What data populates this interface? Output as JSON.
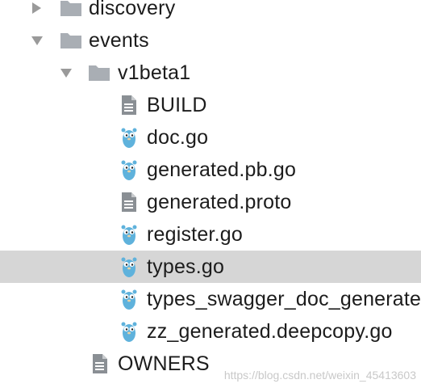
{
  "colors": {
    "folder": "#a9aeb4",
    "arrow": "#9a9a9a",
    "file": "#8a8f94",
    "gopher": "#5fb2dc",
    "selection": "#d6d6d6"
  },
  "tree": {
    "items": [
      {
        "label": "discovery",
        "type": "folder",
        "expanded": false,
        "icon": "folder-icon"
      },
      {
        "label": "events",
        "type": "folder",
        "expanded": true,
        "icon": "folder-icon"
      },
      {
        "label": "v1beta1",
        "type": "folder",
        "expanded": true,
        "icon": "folder-icon"
      },
      {
        "label": "BUILD",
        "type": "text-file",
        "icon": "text-file-icon"
      },
      {
        "label": "doc.go",
        "type": "go-file",
        "icon": "go-gopher-icon"
      },
      {
        "label": "generated.pb.go",
        "type": "go-file",
        "icon": "go-gopher-icon"
      },
      {
        "label": "generated.proto",
        "type": "text-file",
        "icon": "text-file-icon"
      },
      {
        "label": "register.go",
        "type": "go-file",
        "icon": "go-gopher-icon"
      },
      {
        "label": "types.go",
        "type": "go-file",
        "icon": "go-gopher-icon",
        "selected": true
      },
      {
        "label": "types_swagger_doc_generated.go",
        "type": "go-file",
        "icon": "go-gopher-icon"
      },
      {
        "label": "zz_generated.deepcopy.go",
        "type": "go-file",
        "icon": "go-gopher-icon"
      },
      {
        "label": "OWNERS",
        "type": "text-file",
        "icon": "text-file-icon"
      }
    ]
  },
  "watermark": "https://blog.csdn.net/weixin_45413603"
}
